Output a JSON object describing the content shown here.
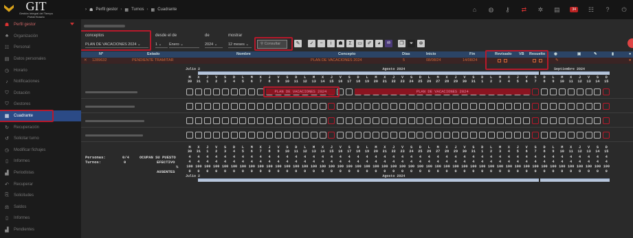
{
  "app": {
    "name": "GIT",
    "subtitle1": "Gestión Integral del Tiempo",
    "subtitle2": "Portal Horario"
  },
  "breadcrumb": [
    "Perfil gestor",
    "Turnos",
    "Cuadrante"
  ],
  "topbar": {
    "badge": "34"
  },
  "sidebar": [
    {
      "label": "Perfil gestor",
      "icon": "user-icon"
    },
    {
      "label": "Organización",
      "icon": "org-icon"
    },
    {
      "label": "Personal",
      "icon": "people-icon"
    },
    {
      "label": "Datos personales",
      "icon": "id-card-icon"
    },
    {
      "label": "Horario",
      "icon": "clock-icon"
    },
    {
      "label": "Notificaciones",
      "icon": "bell-icon"
    },
    {
      "label": "Dotación",
      "icon": "shield-icon"
    },
    {
      "label": "Gestores",
      "icon": "shield-icon"
    },
    {
      "label": "Cuadrante",
      "icon": "grid-icon"
    },
    {
      "label": "Recuperación",
      "icon": "refresh-icon"
    },
    {
      "label": "Solicitar turno",
      "icon": "rotate-icon"
    },
    {
      "label": "Modificar fichajes",
      "icon": "clock-icon"
    },
    {
      "label": "Informes",
      "icon": "document-icon"
    },
    {
      "label": "Periodistas",
      "icon": "chart-icon"
    },
    {
      "label": "Recuperar",
      "icon": "recover-icon"
    },
    {
      "label": "Solicitudes",
      "icon": "request-icon"
    },
    {
      "label": "Saldos",
      "icon": "balance-icon"
    },
    {
      "label": "Informes",
      "icon": "document-icon"
    },
    {
      "label": "Pendientes",
      "icon": "chart-icon"
    }
  ],
  "filters": {
    "conceptos_label": "conceptos",
    "conceptos_value": "PLAN DE VACACIONES 2024",
    "desde_label": "desde el de",
    "desde_day": "1",
    "desde_month": "Enero",
    "de_label": "de",
    "year": "2024",
    "mostrar_label": "mostrar",
    "mostrar_value": "12 meses",
    "consultar_label": "Consultar"
  },
  "table": {
    "headers": {
      "num": "Nº",
      "estado": "Estado",
      "nombre": "Nombre",
      "concepto": "Concepto",
      "dias": "Días",
      "inicio": "Inicio",
      "fin": "Fin",
      "revisado": "Revisado",
      "vb": "VB",
      "resuelto": "Resuelto"
    },
    "row": {
      "num": "1289632",
      "estado": "PENDIENTE TRAMITAR",
      "nombre": "",
      "concepto": "PLAN DE VACACIONES 2024",
      "dias": "5",
      "inicio": "08/08/24",
      "fin": "14/08/24"
    }
  },
  "calendar": {
    "month_labels": [
      {
        "label": "Julio 2",
        "col": 0
      },
      {
        "label": "Agosto 2024",
        "col": 16
      },
      {
        "label": "Septiembre 2024",
        "col": 40
      }
    ],
    "weekdays": [
      "M",
      "X",
      "J",
      "V",
      "S",
      "D",
      "L",
      "M",
      "X",
      "J",
      "V",
      "S",
      "D",
      "L",
      "M",
      "X",
      "J",
      "V",
      "S",
      "D",
      "L",
      "M",
      "X",
      "J",
      "V",
      "S",
      "D",
      "L",
      "M",
      "X",
      "J",
      "V",
      "S",
      "D",
      "L",
      "M",
      "X",
      "J",
      "V",
      "S",
      "D",
      "L",
      "M",
      "X",
      "J",
      "V",
      "S",
      "D"
    ],
    "days": [
      "30",
      "31",
      "1",
      "2",
      "3",
      "4",
      "5",
      "6",
      "7",
      "8",
      "9",
      "10",
      "11",
      "12",
      "13",
      "14",
      "15",
      "16",
      "17",
      "18",
      "19",
      "20",
      "21",
      "22",
      "23",
      "24",
      "25",
      "26",
      "27",
      "28",
      "29",
      "30",
      "31",
      "1",
      "2",
      "3",
      "4",
      "5",
      "6",
      "7",
      "8",
      "9",
      "10",
      "11",
      "12",
      "13",
      "14",
      "15"
    ],
    "vacation_label": "PLAN DE VACACIONES 2024",
    "stats": {
      "personas_label": "Personas:",
      "personas_value": "0/4",
      "turnos_label": "Turnos:",
      "turnos_value": "0",
      "ocupan_label": "OCUPAN SU PUESTO",
      "efectivo_label": "EFECTIVO",
      "pct_label": "%",
      "ausentes_label": "AUSENTES",
      "ocupan_value": "4",
      "efectivo_value": "4",
      "pct_value": "100",
      "ausentes_value": "0"
    },
    "footer_month_labels": [
      {
        "label": "Julio 2",
        "col": 0
      },
      {
        "label": "Agosto 2024",
        "col": 16
      }
    ]
  }
}
